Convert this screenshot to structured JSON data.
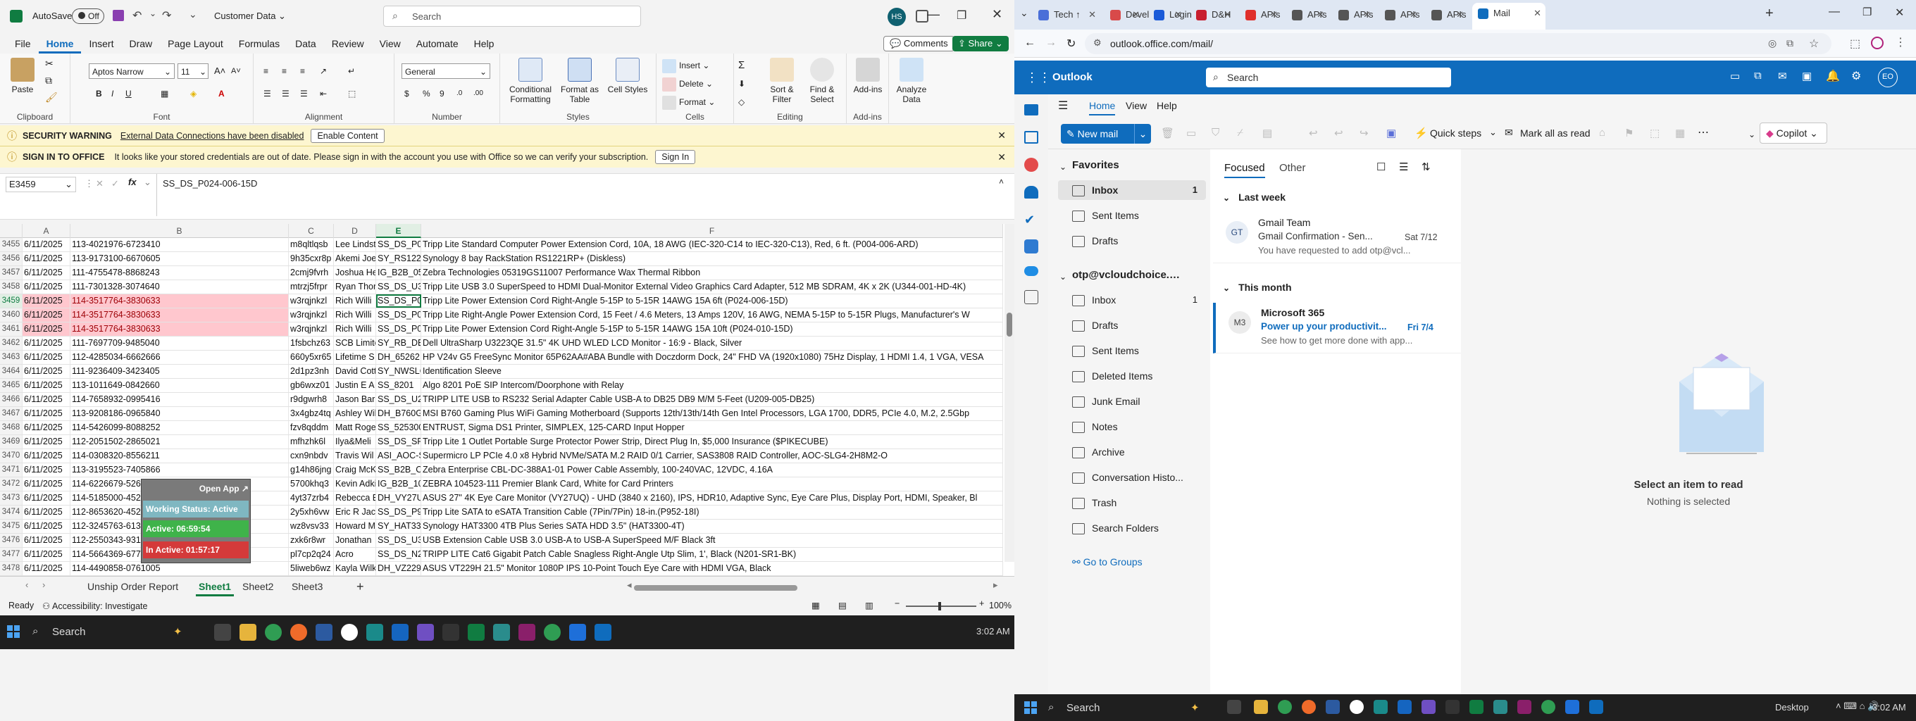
{
  "excel": {
    "autosave_label": "AutoSave",
    "autosave_state": "Off",
    "filename": "Customer Data",
    "search_placeholder": "Search",
    "user_initials": "HS",
    "menu_tabs": [
      "File",
      "Home",
      "Insert",
      "Draw",
      "Page Layout",
      "Formulas",
      "Data",
      "Review",
      "View",
      "Automate",
      "Help"
    ],
    "comments_label": "Comments",
    "share_label": "Share",
    "ribbon": {
      "paste": "Paste",
      "clipboard": "Clipboard",
      "font_name": "Aptos Narrow",
      "font_size": "11",
      "font": "Font",
      "alignment": "Alignment",
      "number_format": "General",
      "number": "Number",
      "conditional": "Conditional Formatting",
      "format_table": "Format as Table",
      "cell_styles": "Cell Styles",
      "styles": "Styles",
      "insert": "Insert",
      "delete": "Delete",
      "format": "Format",
      "cells": "Cells",
      "sort_filter": "Sort & Filter",
      "find_select": "Find & Select",
      "editing": "Editing",
      "addins": "Add-ins",
      "analyze": "Analyze Data"
    },
    "security_warning": {
      "title": "SECURITY WARNING",
      "message": "External Data Connections have been disabled",
      "button": "Enable Content"
    },
    "signin_warning": {
      "title": "SIGN IN TO OFFICE",
      "message": "It looks like your stored credentials are out of date. Please sign in with the account you use with Office so we can verify your subscription.",
      "button": "Sign In"
    },
    "name_box": "E3459",
    "formula_value": "SS_DS_P024-006-15D",
    "columns": [
      "A",
      "B",
      "C",
      "D",
      "E",
      "F"
    ],
    "rows": [
      {
        "n": "3455",
        "a": "6/11/2025",
        "b": "113-4021976-6723410",
        "c": "m8qltlqsb",
        "d": "Lee Lindst",
        "e": "SS_DS_P0(",
        "f": "Tripp Lite Standard Computer Power Extension Cord, 10A, 18 AWG (IEC-320-C14 to IEC-320-C13), Red, 6 ft. (P004-006-ARD)"
      },
      {
        "n": "3456",
        "a": "6/11/2025",
        "b": "113-9173100-6670605",
        "c": "9h35cxr8p",
        "d": "Akemi Joe",
        "e": "SY_RS1221",
        "f": "Synology 8 bay RackStation RS1221RP+ (Diskless)"
      },
      {
        "n": "3457",
        "a": "6/11/2025",
        "b": "111-4755478-8868243",
        "c": "2cmj9fvrh",
        "d": "Joshua He",
        "e": "IG_B2B_05",
        "f": "Zebra Technologies 05319GS11007 Performance Wax Thermal Ribbon"
      },
      {
        "n": "3458",
        "a": "6/11/2025",
        "b": "111-7301328-3074640",
        "c": "mtrzj5frpr",
        "d": "Ryan Thor",
        "e": "SS_DS_U3(",
        "f": "Tripp Lite USB 3.0 SuperSpeed to HDMI Dual-Monitor External Video Graphics Card Adapter, 512 MB SDRAM, 4K x 2K (U344-001-HD-4K)"
      },
      {
        "n": "3459",
        "a": "6/11/2025",
        "b": "114-3517764-3830633",
        "c": "w3rqjnkzl",
        "d": "Rich Willi",
        "e": "SS_DS_P02",
        "f": "Tripp Lite Power Extension Cord Right-Angle 5-15P to 5-15R 14AWG 15A 6ft (P024-006-15D)",
        "pink": true,
        "sel": true
      },
      {
        "n": "3460",
        "a": "6/11/2025",
        "b": "114-3517764-3830633",
        "c": "w3rqjnkzl",
        "d": "Rich Willi",
        "e": "SS_DS_P02",
        "f": "Tripp Lite Right-Angle Power Extension Cord, 15 Feet / 4.6 Meters, 13 Amps 120V, 16 AWG, NEMA 5-15P to 5-15R Plugs, Manufacturer's W",
        "pink": true
      },
      {
        "n": "3461",
        "a": "6/11/2025",
        "b": "114-3517764-3830633",
        "c": "w3rqjnkzl",
        "d": "Rich Willi",
        "e": "SS_DS_P02",
        "f": "Tripp Lite Power Extension Cord Right-Angle 5-15P to 5-15R 14AWG 15A 10ft (P024-010-15D)",
        "pink": true
      },
      {
        "n": "3462",
        "a": "6/11/2025",
        "b": "111-7697709-9485040",
        "c": "1fsbchz63",
        "d": "SCB Limite",
        "e": "SY_RB_DEI",
        "f": "Dell UltraSharp U3223QE 31.5\" 4K UHD WLED LCD Monitor - 16:9 - Black, Silver"
      },
      {
        "n": "3463",
        "a": "6/11/2025",
        "b": "112-4285034-6662666",
        "c": "660y5xr65",
        "d": "Lifetime S",
        "e": "DH_65262",
        "f": "HP V24v G5 FreeSync Monitor 65P62AA#ABA Bundle with Doczdorm Dock, 24\" FHD VA (1920x1080) 75Hz Display, 1 HDMI 1.4, 1 VGA, VESA"
      },
      {
        "n": "3464",
        "a": "6/11/2025",
        "b": "111-9236409-3423405",
        "c": "2d1pz3nh",
        "d": "David Cott",
        "e": "SY_NWSLC",
        "f": "Identification Sleeve"
      },
      {
        "n": "3465",
        "a": "6/11/2025",
        "b": "113-1011649-0842660",
        "c": "gb6wxz01",
        "d": "Justin E A",
        "e": "SS_8201",
        "f": "   Algo 8201 PoE SIP Intercom/Doorphone with Relay"
      },
      {
        "n": "3466",
        "a": "6/11/2025",
        "b": "114-7658932-0995416",
        "c": "r9dgwrh8",
        "d": "Jason Bar",
        "e": "SS_DS_U2(",
        "f": "TRIPP LITE USB to RS232 Serial Adapter Cable USB-A to DB25 DB9 M/M 5-Feet (U209-005-DB25)"
      },
      {
        "n": "3467",
        "a": "6/11/2025",
        "b": "113-9208186-0965840",
        "c": "3x4gbz4tq",
        "d": "Ashley Wil",
        "e": "DH_B760G",
        "f": "MSI B760 Gaming Plus WiFi Gaming Motherboard (Supports 12th/13th/14th Gen Intel Processors, LGA 1700, DDR5, PCIe 4.0, M.2, 2.5Gbp"
      },
      {
        "n": "3468",
        "a": "6/11/2025",
        "b": "114-5426099-8088252",
        "c": "fzv8qddm",
        "d": "Matt Roge",
        "e": "SS_525300",
        "f": "ENTRUST, Sigma DS1 Printer, SIMPLEX, 125-CARD Input Hopper"
      },
      {
        "n": "3469",
        "a": "6/11/2025",
        "b": "112-2051502-2865021",
        "c": "mfhzhk6l",
        "d": "Ilya&Meli",
        "e": "SS_DS_SPI",
        "f": "Tripp Lite 1 Outlet Portable Surge Protector Power Strip, Direct Plug In, $5,000 Insurance ($PIKECUBE)"
      },
      {
        "n": "3470",
        "a": "6/11/2025",
        "b": "114-0308320-8556211",
        "c": "cxn9nbdv",
        "d": "Travis Wil",
        "e": "ASI_AOC-S",
        "f": "Supermicro LP PCIe 4.0 x8 Hybrid NVMe/SATA M.2 RAID 0/1 Carrier, SAS3808 RAID Controller, AOC-SLG4-2H8M2-O"
      },
      {
        "n": "3471",
        "a": "6/11/2025",
        "b": "113-3195523-7405866",
        "c": "g14h86jng",
        "d": "Craig McK",
        "e": "SS_B2B_CE",
        "f": "Zebra Enterprise CBL-DC-388A1-01 Power Cable Assembly, 100-240VAC, 12VDC, 4.16A"
      },
      {
        "n": "3472",
        "a": "6/11/2025",
        "b": "114-6226679-5267452",
        "c": "5700khq3",
        "d": "Kevin Adki",
        "e": "IG_B2B_10",
        "f": "ZEBRA 104523-111 Premier Blank Card, White for Card Printers"
      },
      {
        "n": "3473",
        "a": "6/11/2025",
        "b": "114-5185000-4527633",
        "c": "4yt37zrb4",
        "d": "Rebecca E",
        "e": "DH_VY27U",
        "f": "ASUS 27\" 4K Eye Care Monitor (VY27UQ) - UHD (3840 x 2160), IPS, HDR10, Adaptive Sync, Eye Care Plus, Display Port, HDMI, Speaker, Bl"
      },
      {
        "n": "3474",
        "f": "Tripp Lite SATA to eSATA Transition Cable (7Pin/7Pin) 18-in.(P952-18I)",
        "a": "6/11/2025",
        "b": "112-8653620-4528616",
        "c": "2y5xh6vw",
        "d": "Eric R Jac",
        "e": "SS_DS_P95"
      },
      {
        "n": "3475",
        "a": "6/11/2025",
        "b": "112-3245763-6134244",
        "c": "wz8vsv33",
        "d": "Howard M",
        "e": "SY_HAT33(",
        "f": "Synology HAT3300 4TB Plus Series SATA HDD 3.5\" (HAT3300-4T)"
      },
      {
        "n": "3476",
        "a": "6/11/2025",
        "b": "112-2550343-9315459",
        "c": "zxk6r8wr",
        "d": "Jonathan",
        "e": "SS_DS_U32",
        "f": "USB Extension Cable USB 3.0 USB-A to USB-A SuperSpeed M/F Black 3ft"
      },
      {
        "n": "3477",
        "a": "6/11/2025",
        "b": "114-5664369-6778264",
        "c": "pl7cp2q24",
        "d": "Acro",
        "e": "SS_DS_N2(",
        "f": "TRIPP LITE Cat6 Gigabit Patch Cable Snagless Right-Angle Utp Slim, 1', Black (N201-SR1-BK)"
      },
      {
        "n": "3478",
        "a": "6/11/2025",
        "b": "114-4490858-0761005",
        "c": "5liweb6wz",
        "d": "Kayla Wilk",
        "e": "DH_VZ229",
        "f": "ASUS VT229H 21.5\" Monitor 1080P IPS 10-Point Touch Eye Care with HDMI VGA, Black"
      }
    ],
    "popup": {
      "open_app": "Open App ↗",
      "working": "Working Status: Active",
      "active": "Active: 06:59:54",
      "inactive": "In Active: 01:57:17"
    },
    "sheet_tabs": [
      "Unship Order Report",
      "Sheet1",
      "Sheet2",
      "Sheet3"
    ],
    "active_sheet": "Sheet1",
    "status_ready": "Ready",
    "status_accessibility": "Accessibility: Investigate",
    "zoom": "100%"
  },
  "taskbar_left": {
    "search_placeholder": "Search",
    "time": "3:02 AM"
  },
  "taskbar_right": {
    "search_placeholder": "Search",
    "desktop": "Desktop",
    "time": "3:02 AM"
  },
  "browser": {
    "tabs": [
      {
        "label": "Tech ↑",
        "color": "#4a6fd8"
      },
      {
        "label": "Devel",
        "color": "#d84a4a"
      },
      {
        "label": "Login",
        "color": "#1a5ad8"
      },
      {
        "label": "D&H",
        "color": "#c81e2e"
      },
      {
        "label": "APIs",
        "color": "#e0302c"
      },
      {
        "label": "APIs",
        "color": "#555"
      },
      {
        "label": "APIs",
        "color": "#555"
      },
      {
        "label": "APIs",
        "color": "#555"
      },
      {
        "label": "APIs",
        "color": "#555"
      },
      {
        "label": "Mail",
        "color": "#0f6cbd"
      }
    ],
    "url": "outlook.office.com/mail/"
  },
  "outlook": {
    "app_name": "Outlook",
    "search_placeholder": "Search",
    "user_initials": "EO",
    "nav_tabs": [
      "Home",
      "View",
      "Help"
    ],
    "new_mail": "New mail",
    "quick_steps": "Quick steps",
    "mark_all_read": "Mark all as read",
    "copilot": "Copilot",
    "favorites_header": "Favorites",
    "favorites": [
      {
        "label": "Inbox",
        "count": "1"
      },
      {
        "label": "Sent Items",
        "count": ""
      },
      {
        "label": "Drafts",
        "count": ""
      }
    ],
    "account_header": "otp@vcloudchoice.…",
    "account_folders": [
      {
        "label": "Inbox",
        "count": "1"
      },
      {
        "label": "Drafts",
        "count": ""
      },
      {
        "label": "Sent Items",
        "count": ""
      },
      {
        "label": "Deleted Items",
        "count": ""
      },
      {
        "label": "Junk Email",
        "count": ""
      },
      {
        "label": "Notes",
        "count": ""
      },
      {
        "label": "Archive",
        "count": ""
      },
      {
        "label": "Conversation Histo...",
        "count": ""
      },
      {
        "label": "Trash",
        "count": ""
      },
      {
        "label": "Search Folders",
        "count": ""
      }
    ],
    "go_to_groups": "Go to Groups",
    "focused": "Focused",
    "other": "Other",
    "groups": [
      {
        "header": "Last week",
        "items": [
          {
            "initials": "GT",
            "sender": "Gmail Team",
            "subject": "Gmail Confirmation - Sen...",
            "date": "Sat 7/12",
            "preview": "You have requested to add otp@vcl...",
            "avatar_color": "#e8eef6",
            "avatar_text": "#2b4a7d"
          }
        ]
      },
      {
        "header": "This month",
        "items": [
          {
            "initials": "M3",
            "sender": "Microsoft 365",
            "subject": "Power up your productivit...",
            "date": "Fri 7/4",
            "preview": "See how to get more done with app...",
            "avatar_color": "#ececec",
            "avatar_text": "#444"
          }
        ]
      }
    ],
    "empty_title": "Select an item to read",
    "empty_subtitle": "Nothing is selected"
  }
}
